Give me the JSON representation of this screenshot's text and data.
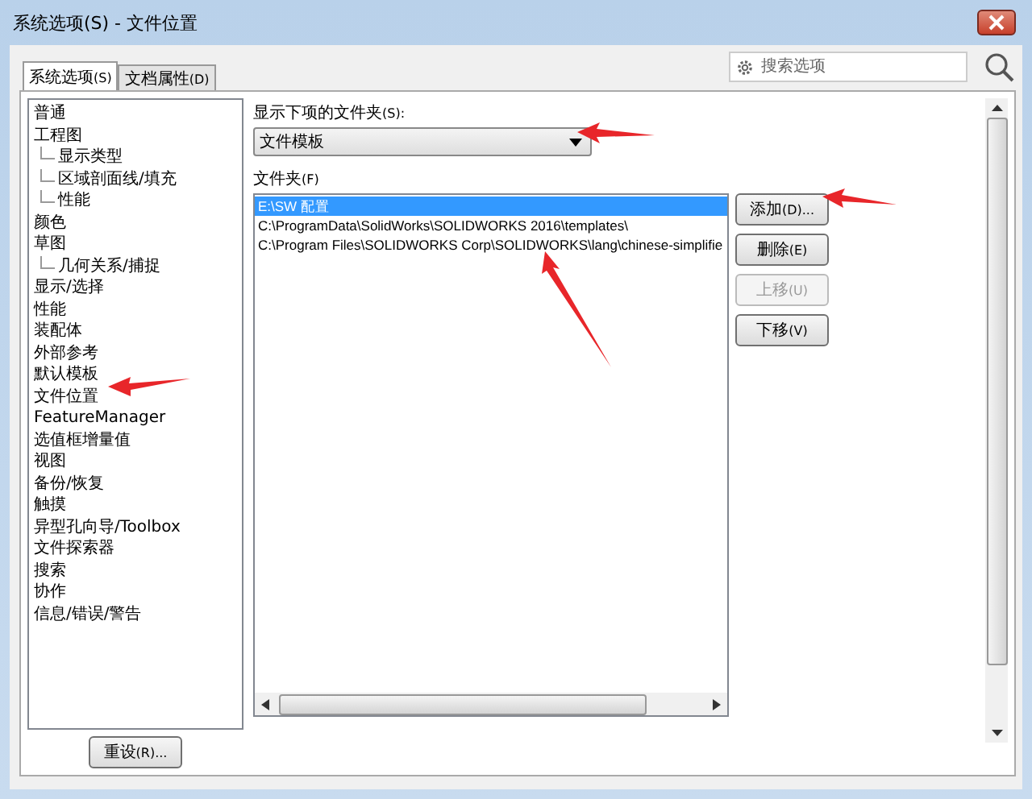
{
  "window": {
    "title": "系统选项(S) - 文件位置"
  },
  "tabs": [
    {
      "label": "系统选项",
      "key": "(S)",
      "selected": true
    },
    {
      "label": "文档属性",
      "key": "(D)",
      "selected": false
    }
  ],
  "search": {
    "placeholder": "搜索选项"
  },
  "tree": [
    {
      "label": "普通"
    },
    {
      "label": "工程图",
      "children": [
        {
          "label": "显示类型"
        },
        {
          "label": "区域剖面线/填充"
        },
        {
          "label": "性能"
        }
      ]
    },
    {
      "label": "颜色"
    },
    {
      "label": "草图",
      "children": [
        {
          "label": "几何关系/捕捉"
        }
      ]
    },
    {
      "label": "显示/选择"
    },
    {
      "label": "性能"
    },
    {
      "label": "装配体"
    },
    {
      "label": "外部参考"
    },
    {
      "label": "默认模板"
    },
    {
      "label": "文件位置"
    },
    {
      "label": "FeatureManager"
    },
    {
      "label": "选值框增量值"
    },
    {
      "label": "视图"
    },
    {
      "label": "备份/恢复"
    },
    {
      "label": "触摸"
    },
    {
      "label": "异型孔向导/Toolbox"
    },
    {
      "label": "文件探索器"
    },
    {
      "label": "搜索"
    },
    {
      "label": "协作"
    },
    {
      "label": "信息/错误/警告"
    }
  ],
  "reset_button": {
    "label": "重设",
    "key": "(R)..."
  },
  "show_folders": {
    "label": "显示下项的文件夹",
    "key": "(S):",
    "value": "文件模板"
  },
  "folders": {
    "label": "文件夹",
    "key": "(F)",
    "rows": [
      {
        "path": "E:\\SW 配置",
        "selected": true
      },
      {
        "path": "C:\\ProgramData\\SolidWorks\\SOLIDWORKS 2016\\templates\\",
        "selected": false
      },
      {
        "path": "C:\\Program Files\\SOLIDWORKS Corp\\SOLIDWORKS\\lang\\chinese-simplifie",
        "selected": false
      }
    ]
  },
  "buttons": [
    {
      "label": "添加",
      "key": "(D)...",
      "disabled": false
    },
    {
      "label": "删除",
      "key": "(E)",
      "disabled": false
    },
    {
      "label": "上移",
      "key": "(U)",
      "disabled": true
    },
    {
      "label": "下移",
      "key": "(V)",
      "disabled": false
    }
  ]
}
